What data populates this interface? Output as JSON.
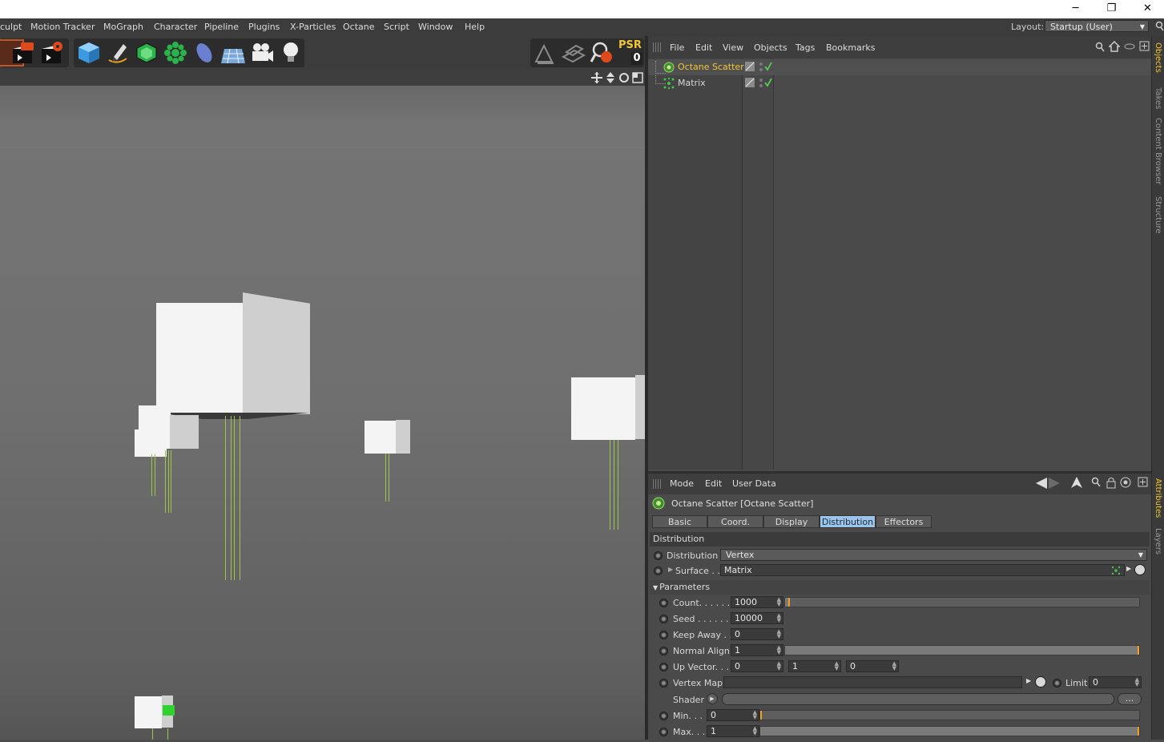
{
  "window": {
    "minimize": "─",
    "restore": "❐",
    "close": "✕"
  },
  "menubar": {
    "items": [
      "culpt",
      "Motion Tracker",
      "MoGraph",
      "Character",
      "Pipeline",
      "Plugins",
      "X-Particles",
      "Octane",
      "Script",
      "Window",
      "Help"
    ],
    "layout_label": "Layout:",
    "layout_value": "Startup (User)"
  },
  "toolbar": {
    "psr_label": "PSR",
    "psr_value": "0"
  },
  "object_manager": {
    "menu": [
      "File",
      "Edit",
      "View",
      "Objects",
      "Tags",
      "Bookmarks"
    ],
    "objects": [
      {
        "name": "Octane Scatter",
        "selected": true,
        "color": "#f2c531"
      },
      {
        "name": "Matrix",
        "selected": false,
        "color": "#d8d8d8"
      }
    ]
  },
  "side_tabs": {
    "objects": "Objects",
    "takes": "Takes",
    "content_browser": "Content Browser",
    "structure": "Structure",
    "attributes": "Attributes",
    "layers": "Layers"
  },
  "attributes": {
    "menu": [
      "Mode",
      "Edit",
      "User Data"
    ],
    "title": "Octane Scatter [Octane Scatter]",
    "tabs": [
      "Basic",
      "Coord.",
      "Display",
      "Distribution",
      "Effectors"
    ],
    "active_tab": "Distribution",
    "section": "Distribution",
    "distribution_label": "Distribution",
    "distribution_value": "Vertex",
    "surface_label": "Surface . .",
    "surface_value": "Matrix",
    "parameters_label": "Parameters",
    "count_label": "Count. . . . . .",
    "count_value": "1000",
    "count_level": 0.01,
    "seed_label": "Seed . . . . . .",
    "seed_value": "10000",
    "keepaway_label": "Keep Away . .",
    "keepaway_value": "0",
    "normalalign_label": "Normal Align",
    "normalalign_value": "1",
    "normalalign_level": 1.0,
    "upvector_label": "Up Vector. . .",
    "upvector_values": [
      "0",
      "1",
      "0"
    ],
    "vertexmap_label": "Vertex Map",
    "limit_label": "Limit",
    "limit_value": "0",
    "shader_label": "Shader",
    "shader_btn": "...",
    "min_label": "Min. . .",
    "min_value": "0",
    "min_level": 0.0,
    "max_label": "Max. . .",
    "max_value": "1",
    "max_level": 1.0
  },
  "colors": {
    "accent": "#f2c531",
    "active_tab": "#9cc4ea",
    "strand": "#9ec44a",
    "slider_mark": "#f0a020"
  }
}
